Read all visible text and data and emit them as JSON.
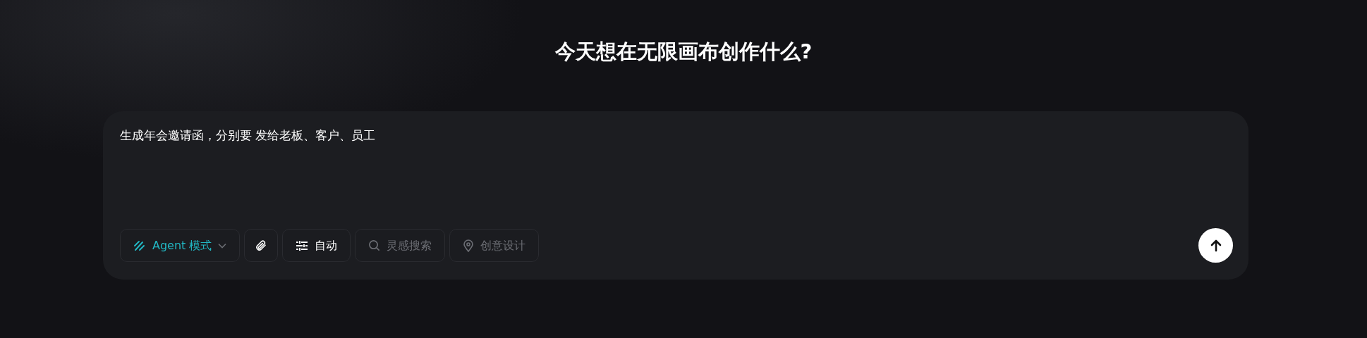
{
  "heading": "今天想在无限画布创作什么?",
  "prompt": {
    "value": "生成年会邀请函，分别要 发给老板、客户、员工"
  },
  "tools": [
    {
      "kind": "mode",
      "label": "Agent 模式"
    },
    {
      "kind": "attach"
    },
    {
      "kind": "setting",
      "label": "自动"
    },
    {
      "kind": "search",
      "label": "灵感搜索",
      "on": false
    },
    {
      "kind": "idea",
      "label": "创意设计",
      "on": false
    }
  ],
  "send": {
    "disabled": false
  }
}
